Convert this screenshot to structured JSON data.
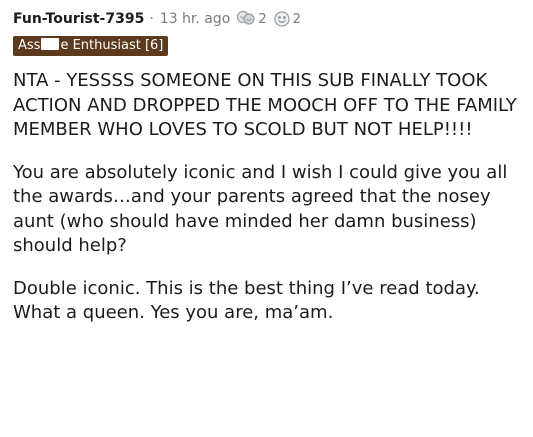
{
  "comment": {
    "username": "Fun-Tourist-7395",
    "separator": "·",
    "time": "13 hr. ago",
    "awards": [
      {
        "icon": "helpful-award-icon",
        "count": "2"
      },
      {
        "icon": "wholesome-award-icon",
        "count": "2"
      }
    ],
    "flair": {
      "prefix": "Ass",
      "suffix": "e Enthusiast [6]",
      "background": "#5b3a1e"
    },
    "paragraphs": [
      "NTA - YESSSS SOMEONE ON THIS SUB FINALLY TOOK ACTION AND DROPPED THE MOOCH OFF TO THE FAMILY MEMBER WHO LOVES TO SCOLD BUT NOT HELP!!!!",
      "You are absolutely iconic and I wish I could give you all the awards…and your parents agreed that the nosey aunt (who should have minded her damn business) should help?",
      "Double iconic. This is the best thing I’ve read today. What a queen. Yes you are, ma’am."
    ]
  }
}
